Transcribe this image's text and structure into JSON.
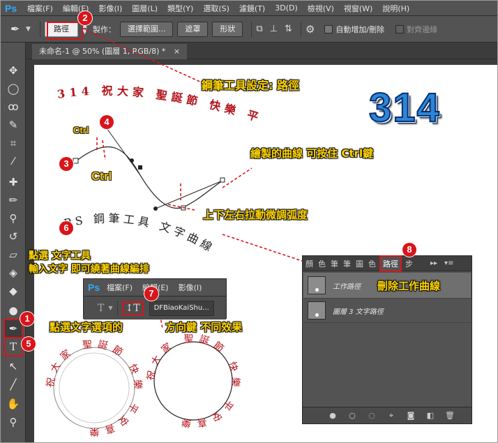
{
  "app": {
    "logo": "Ps"
  },
  "menu": [
    "檔案(F)",
    "編輯(E)",
    "影像(I)",
    "圖層(L)",
    "類型(Y)",
    "選取(S)",
    "濾鏡(T)",
    "3D(D)",
    "檢視(V)",
    "視窗(W)",
    "說明(H)"
  ],
  "options_bar": {
    "mode_value": "路徑",
    "make_label": "製作：",
    "selection_button": "選擇範圍...",
    "mask_button": "遮罩",
    "shape_button": "形狀",
    "auto_add_delete": "自動增加/刪除",
    "align_edges": "對齊邊緣"
  },
  "document_tab": {
    "title": "未命名-1 @ 50% (圖層 1, RGB/8) *",
    "close": "×"
  },
  "canvas": {
    "curved_text_top": "314 祝大家 聖誕節 快樂 平安喜樂",
    "big_number": "314",
    "ctrl_1": "Ctrl",
    "ctrl_2": "Ctrl",
    "path_text": "PS 鋼筆工具 文字曲線 繪製"
  },
  "notes": {
    "pen_setting": "鋼筆工具設定: 路徑",
    "ctrl_curve": "繪製的曲線 可按住 Ctrl鍵",
    "adjust_arc": "上下左右拉動微調弧度",
    "text_tool_1": "點選 文字工具",
    "text_tool_2": "輸入文字 即可繞著曲線編排",
    "direction": "點選文字選項的",
    "direction_2": "方向鍵 不同效果",
    "delete_path": "刪除工作曲線"
  },
  "badges": [
    "1",
    "2",
    "3",
    "4",
    "5",
    "6",
    "7",
    "8"
  ],
  "paths_panel": {
    "tabs": [
      "顏",
      "色",
      "筆",
      "筆",
      "圖",
      "色",
      "路徑",
      "步"
    ],
    "rows": [
      {
        "label": "工作路徑"
      },
      {
        "label": "圖層 3 文字路徑"
      }
    ]
  },
  "sub_window": {
    "logo": "Ps",
    "menu": [
      "檔案(F)",
      "編輯(E)",
      "影像(I)"
    ],
    "font_field": "DFBiaoKaiShu..."
  },
  "circles": {
    "left_text": "祝大家 聖誕節 快樂 平安喜樂",
    "right_text": "祝大家 聖誕節 快樂 平安喜樂"
  },
  "colors": {
    "accent_red": "#d9141b",
    "note_yellow": "#ffd400",
    "text_red": "#b3141b",
    "text_blue": "#1b2f8c"
  }
}
